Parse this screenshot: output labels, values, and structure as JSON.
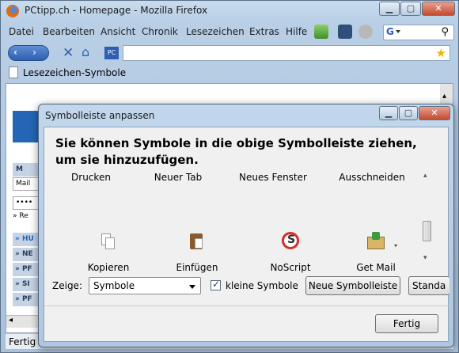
{
  "browser": {
    "title": "PCtipp.ch - Homepage - Mozilla Firefox",
    "menu": [
      "Datei",
      "Bearbeiten",
      "Ansicht",
      "Chronik",
      "Lesezeichen",
      "Extras",
      "Hilfe"
    ],
    "search_engine_icon": "G",
    "bookmarks_label": "Lesezeichen-Symbole",
    "status_text": "Fertig",
    "page_left_items": [
      "M",
      "Mail",
      "••••",
      "» Re",
      "» HU",
      "» NE",
      "» PF",
      "» SI",
      "» PF"
    ]
  },
  "dialog": {
    "title": "Symbolleiste anpassen",
    "heading": "Sie können Symbole in die obige Symbolleiste ziehen, um sie hinzuzufügen.",
    "palette_row1": [
      "Drucken",
      "Neuer Tab",
      "Neues Fenster",
      "Ausschneiden"
    ],
    "palette_row2": [
      {
        "label": "Kopieren",
        "icon": "copy-icon"
      },
      {
        "label": "Einfügen",
        "icon": "paste-icon"
      },
      {
        "label": "NoScript",
        "icon": "noscript-icon"
      },
      {
        "label": "Get Mail",
        "icon": "get-mail-icon"
      }
    ],
    "show_label": "Zeige:",
    "show_value": "Symbole",
    "small_icons_label": "kleine Symbole",
    "new_toolbar_button": "Neue Symbolleiste",
    "default_button": "Standa",
    "done_button": "Fertig"
  },
  "colors": {
    "accent": "#2e5fb0",
    "noscript_red": "#d42d2d"
  }
}
